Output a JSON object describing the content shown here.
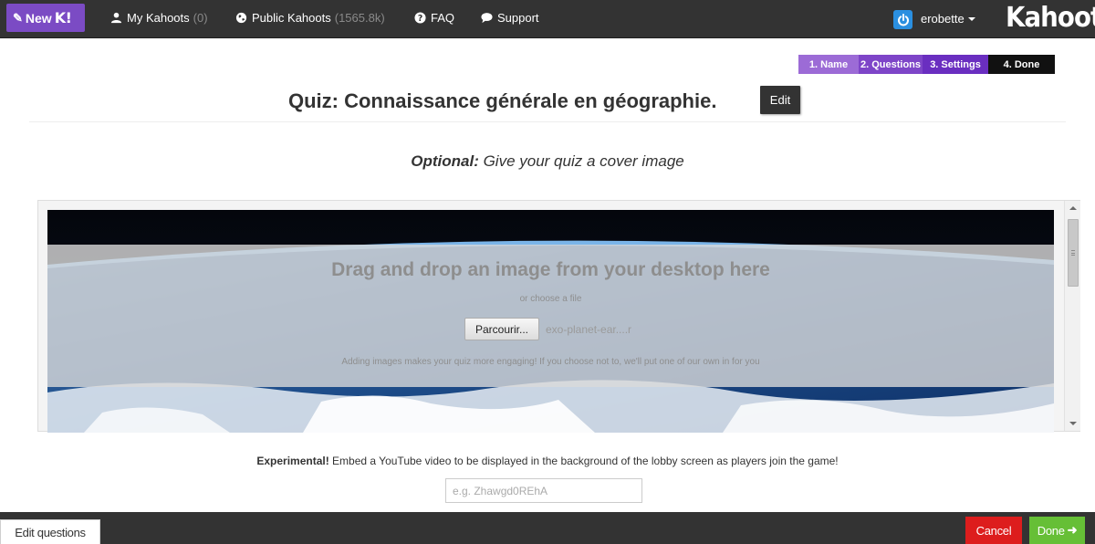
{
  "topbar": {
    "new_label": "New",
    "new_k": "K!",
    "my_kahoots_label": "My Kahoots",
    "my_kahoots_count": "(0)",
    "public_kahoots_label": "Public Kahoots",
    "public_kahoots_count": "(1565.8k)",
    "faq_label": "FAQ",
    "support_label": "Support",
    "username": "erobette",
    "logo": "Kahoot!"
  },
  "steps": [
    "1. Name",
    "2. Questions",
    "3. Settings",
    "4. Done"
  ],
  "quiz": {
    "title": "Quiz: Connaissance générale en géographie.",
    "edit_label": "Edit"
  },
  "cover": {
    "optional_bold": "Optional:",
    "optional_text": " Give your quiz a cover image",
    "drag_text": "Drag and drop an image from your desktop here",
    "choose_text": "or choose a file",
    "browse_label": "Parcourir...",
    "file_name": "exo-planet-ear....r",
    "hint": "Adding images makes your quiz more engaging! If you choose not to, we'll put one of our own in for you"
  },
  "youtube": {
    "bold": "Experimental!",
    "text": " Embed a YouTube video to be displayed in the background of the lobby screen as players join the game!",
    "placeholder": "e.g. Zhawgd0REhA"
  },
  "footer": {
    "edit_questions": "Edit questions",
    "cancel": "Cancel",
    "done": "Done"
  },
  "colors": {
    "topbar": "#333333",
    "new_button": "#7b4bc4",
    "step_active": "#111111",
    "cancel": "#dd1d1d",
    "done": "#66bf36",
    "power": "#2a8fe0"
  },
  "icons": [
    "pencil-icon",
    "user-icon",
    "globe-icon",
    "question-circle-icon",
    "speech-bubble-icon",
    "power-icon",
    "caret-down-icon",
    "arrow-right-icon"
  ]
}
